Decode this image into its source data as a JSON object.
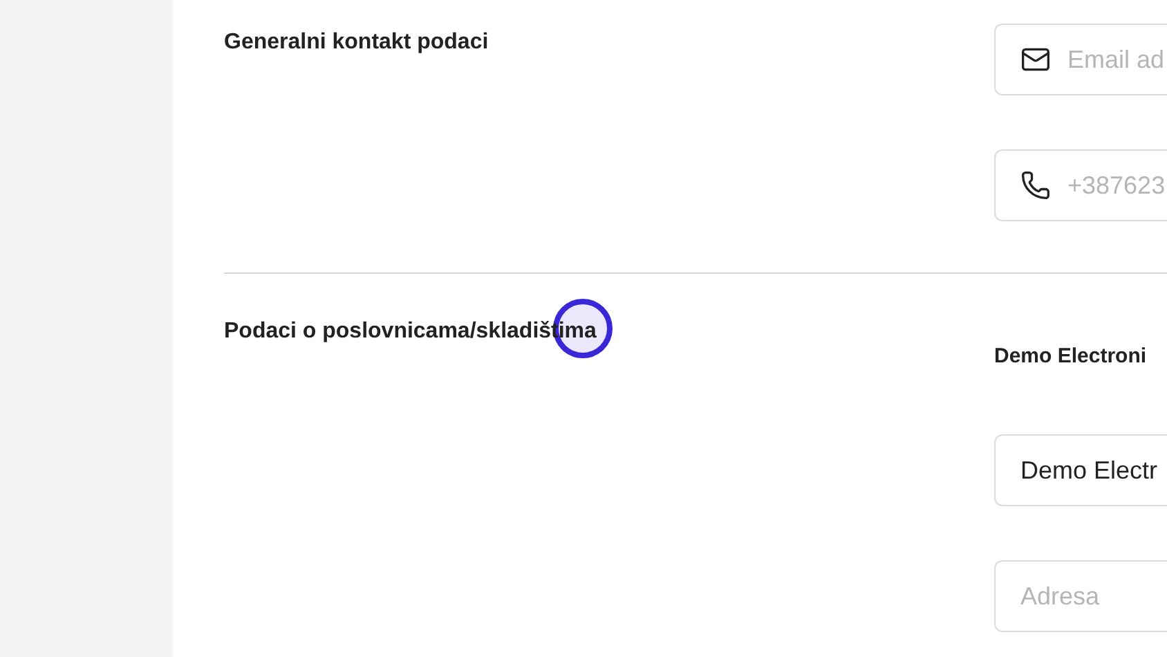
{
  "sections": [
    {
      "title": "Generalni kontakt podaci",
      "fields": [
        {
          "kind": "email",
          "placeholder": "Email ad"
        },
        {
          "kind": "phone",
          "placeholder": "+387623"
        }
      ]
    },
    {
      "title": "Podaci o poslovnicama/skladištima",
      "subtitle": "Demo Electroni",
      "fields": [
        {
          "kind": "text",
          "value": "Demo Electr"
        },
        {
          "kind": "text",
          "placeholder": "Adresa"
        }
      ]
    }
  ],
  "click_marker": {
    "visible": true
  }
}
